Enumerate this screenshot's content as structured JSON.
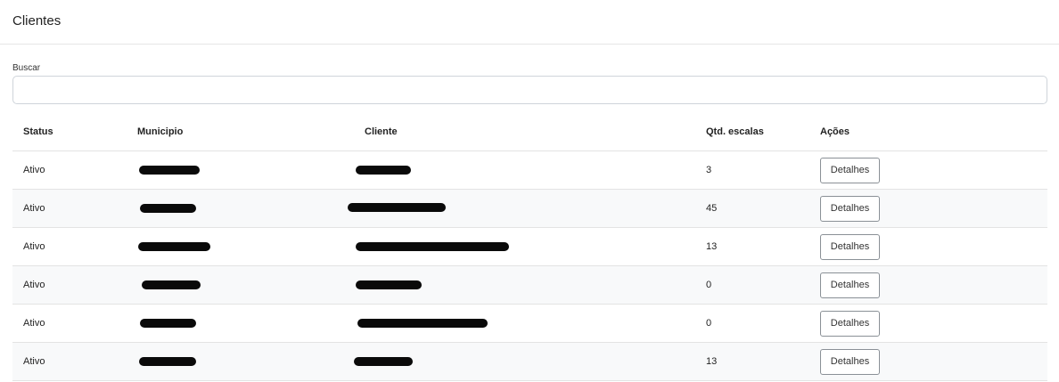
{
  "page": {
    "title": "Clientes"
  },
  "search": {
    "label": "Buscar",
    "value": "",
    "placeholder": ""
  },
  "table": {
    "headers": {
      "status": "Status",
      "municipio": "Municipio",
      "cliente": "Cliente",
      "qtd": "Qtd. escalas",
      "acoes": "Ações"
    },
    "rows": [
      {
        "status": "Ativo",
        "qtd": "3",
        "action": "Detalhes"
      },
      {
        "status": "Ativo",
        "qtd": "45",
        "action": "Detalhes"
      },
      {
        "status": "Ativo",
        "qtd": "13",
        "action": "Detalhes"
      },
      {
        "status": "Ativo",
        "qtd": "0",
        "action": "Detalhes"
      },
      {
        "status": "Ativo",
        "qtd": "0",
        "action": "Detalhes"
      },
      {
        "status": "Ativo",
        "qtd": "13",
        "action": "Detalhes"
      }
    ]
  },
  "colors": {
    "redaction": "#0a0a0a",
    "row_stripe": "#f8f9fa",
    "border": "#e3e3e3"
  }
}
